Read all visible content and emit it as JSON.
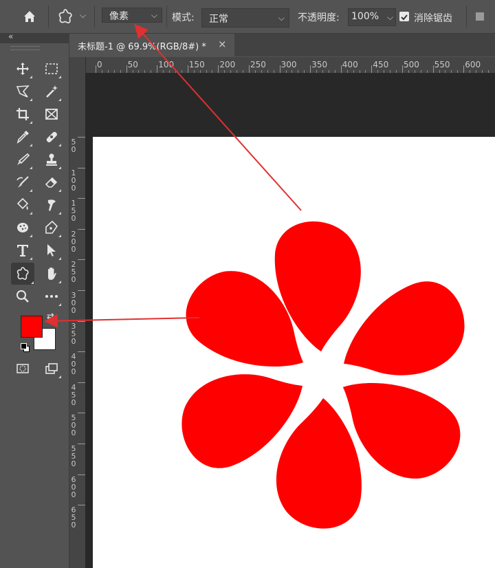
{
  "options_bar": {
    "mode_type": "像素",
    "blend_label": "模式:",
    "blend_value": "正常",
    "opacity_label": "不透明度:",
    "opacity_value": "100%",
    "antialias_checked": true,
    "antialias_label": "消除锯齿"
  },
  "document": {
    "tab_title": "未标题-1 @ 69.9%(RGB/8#) *",
    "close_glyph": "×"
  },
  "rulers": {
    "horizontal": [
      "0",
      "50",
      "100",
      "150",
      "200",
      "250",
      "300",
      "350",
      "400",
      "450",
      "500",
      "550",
      "600"
    ],
    "vertical": [
      "50",
      "100",
      "150",
      "200",
      "250",
      "300",
      "350",
      "400",
      "450",
      "500",
      "550",
      "600",
      "650"
    ]
  },
  "tools": [
    {
      "name": "move-tool",
      "icon": "move-icon"
    },
    {
      "name": "marquee-tool",
      "icon": "rect-marquee-icon"
    },
    {
      "name": "lasso-tool",
      "icon": "lasso-icon"
    },
    {
      "name": "magic-wand-tool",
      "icon": "magic-wand-icon"
    },
    {
      "name": "crop-tool",
      "icon": "crop-icon"
    },
    {
      "name": "frame-tool",
      "icon": "frame-icon"
    },
    {
      "name": "eyedropper-tool",
      "icon": "eyedropper-icon"
    },
    {
      "name": "healing-brush-tool",
      "icon": "bandage-icon"
    },
    {
      "name": "brush-tool",
      "icon": "brush-icon"
    },
    {
      "name": "clone-stamp-tool",
      "icon": "stamp-icon"
    },
    {
      "name": "history-brush-tool",
      "icon": "history-brush-icon"
    },
    {
      "name": "eraser-tool",
      "icon": "eraser-icon"
    },
    {
      "name": "paint-bucket-tool",
      "icon": "paint-bucket-icon"
    },
    {
      "name": "smudge-tool",
      "icon": "smudge-icon"
    },
    {
      "name": "dodge-tool",
      "icon": "sponge-icon"
    },
    {
      "name": "pen-tool",
      "icon": "pen-icon"
    },
    {
      "name": "type-tool",
      "icon": "type-icon"
    },
    {
      "name": "path-selection-tool",
      "icon": "arrow-pointer-icon"
    },
    {
      "name": "custom-shape-tool",
      "icon": "custom-shape-icon"
    },
    {
      "name": "hand-tool",
      "icon": "hand-icon"
    },
    {
      "name": "zoom-tool",
      "icon": "zoom-icon"
    },
    {
      "name": "more-tools",
      "icon": "ellipsis-icon"
    }
  ],
  "colors": {
    "foreground": "#ff0000",
    "background": "#ffffff",
    "annotation_arrow": "#e03030",
    "shape_fill": "#ff0000"
  }
}
